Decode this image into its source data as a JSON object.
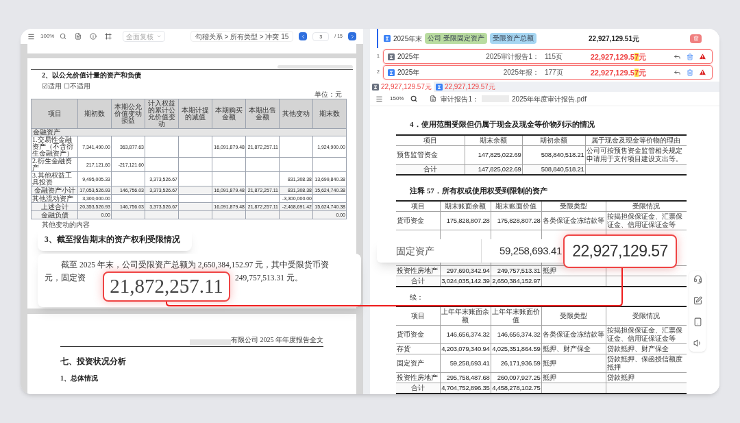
{
  "left_viewer": {
    "toolbar": {
      "zoom": "100%",
      "review_dropdown": "全面复核",
      "filter_path": "勾稽关系 > 所有类型 > 冲突 15",
      "page_input": "3",
      "page_total": "/ 15"
    },
    "page_top": {
      "section_title": "2、以公允价值计量的资产和负债",
      "applicability": "☑适用 ☐不适用",
      "unit": "单位：元",
      "table": {
        "columns": [
          "项目",
          "期初数",
          "本期公允价值变动损益",
          "计入权益的累计公允价值变动",
          "本期计提的减值",
          "本期购买金额",
          "本期出售金额",
          "其他变动",
          "期末数"
        ],
        "rows": [
          {
            "kind": "group",
            "cells": [
              {
                "text": "金融资产",
                "colspan": 9
              }
            ]
          },
          {
            "kind": "data",
            "cells": [
              "1.交易性金融资产（不含衍生金融资产）",
              "7,341,490.00",
              "363,877.63",
              null,
              null,
              "16,091,879.48",
              "21,872,257.11",
              null,
              "1,924,900.00"
            ]
          },
          {
            "kind": "data",
            "cells": [
              "2.衍生金融资产",
              "217,121.60",
              "-217,121.60",
              null,
              null,
              null,
              null,
              null,
              null
            ]
          },
          {
            "kind": "data",
            "cells": [
              "3.其他权益工具投资",
              "9,495,005.33",
              null,
              "3,373,526.67",
              null,
              null,
              null,
              "831,308.38",
              "13,699,840.38"
            ]
          },
          {
            "kind": "total",
            "cells": [
              "金融资产小计",
              "17,053,526.93",
              "146,756.03",
              "3,373,526.67",
              null,
              "16,091,879.48",
              "21,872,257.11",
              "831,308.38",
              "15,624,740.38"
            ]
          },
          {
            "kind": "data",
            "cells": [
              "其他流动资产",
              "3,300,000.00",
              null,
              null,
              null,
              null,
              null,
              "-3,300,000.00",
              null
            ]
          },
          {
            "kind": "total",
            "cells": [
              "上述合计",
              "20,353,526.93",
              "146,756.03",
              "3,373,526.67",
              null,
              "16,091,879.48",
              "21,872,257.11",
              "-2,468,691.42",
              "15,624,740.38"
            ]
          },
          {
            "kind": "total",
            "cells": [
              "金融负债",
              "0.00",
              null,
              null,
              null,
              null,
              null,
              null,
              "0.00"
            ]
          }
        ]
      },
      "note": "其他变动的内容"
    },
    "page_bottom": {
      "header": "有限公司 2025 年年度报告全文",
      "heading": "七、投资状况分析",
      "subheading": "1、总体情况"
    }
  },
  "left_callout": {
    "title": "3、截至报告期末的资产权利受限情况",
    "line_1": "截至 2025 年末，公司受限资产总额为 2,650,384,152.97 元，其中受限货币资",
    "line_2_start": "元，固定资",
    "line_2_end": "249,757,513.31 元。",
    "highlight_value": "21,872,257.11"
  },
  "review_panel": {
    "summary": {
      "year": "2025年末",
      "tags": [
        {
          "label": "公司 受限固定资产",
          "color": "#b9dca0"
        },
        {
          "label": "受限资产总额",
          "color": "#a6d6f2"
        }
      ],
      "amount": "22,927,129.51元"
    },
    "matches": [
      {
        "index": "1",
        "kind": "audit",
        "year": "2025年",
        "source": "2025审计报告1：",
        "page": "115页",
        "amount": "22,927,129.5",
        "diff": "7",
        "unit": "元",
        "conflict": true
      },
      {
        "index": "2",
        "kind": "annual",
        "year": "2025年",
        "source": "2025年报：",
        "page": "177页",
        "amount": "22,927,129.5",
        "diff": "7",
        "unit": "元",
        "conflict": true
      }
    ]
  },
  "value_tabs": [
    {
      "kind": "audit",
      "label": "22,927,129.57元",
      "selected": true
    },
    {
      "kind": "annual",
      "label": "22,927,129.57元",
      "selected": false
    }
  ],
  "doc_toolbar": {
    "zoom": "150%",
    "file_label": "审计报告1：",
    "file_name": "2025年年度审计报告.pdf"
  },
  "document": {
    "title": "4．使用范围受限但仍属于现金及现金等价物列示的情况",
    "table_cash": {
      "columns": [
        "项目",
        "期末余额",
        "期初余额",
        "属于现金及现金等价物的理由"
      ],
      "rows": [
        {
          "kind": "data",
          "cells": [
            "预售监管资金",
            "147,825,022.69",
            "508,840,518.21",
            "公司可按预售资金监管相关规定申请用于支付项目建设支出等。"
          ]
        },
        {
          "kind": "total",
          "cells": [
            "合计",
            "147,825,022.69",
            "508,840,518.21",
            null
          ]
        }
      ]
    },
    "note_title": "注释 57．所有权或使用权受到限制的资产",
    "table_restricted": {
      "columns": [
        "项目",
        "期末账面余额",
        "期末账面价值",
        "受限类型",
        "受限情况"
      ],
      "rows": [
        {
          "kind": "data",
          "cells": [
            "货币资金",
            "175,828,807.28",
            "175,828,807.28",
            "各类保证金冻结款等",
            "按揭担保保证金、汇票保证金、信用证保证金等"
          ]
        },
        {
          "kind": "data",
          "cells": [
            "投资性房地产",
            "297,690,342.94",
            "249,757,513.31",
            "抵押",
            null
          ]
        },
        {
          "kind": "total",
          "cells": [
            "合计",
            "3,024,035,142.39",
            "2,650,384,152.97",
            null,
            null
          ]
        }
      ]
    },
    "continued": "续：",
    "table_prior": {
      "columns": [
        "项目",
        "上年年末账面余额",
        "上年年末账面价值",
        "受限类型",
        "受限情况"
      ],
      "rows": [
        {
          "kind": "data",
          "cells": [
            "货币资金",
            "146,656,374.32",
            "146,656,374.32",
            "各类保证金冻结款等",
            "按揭担保保证金、汇票保证金、信用证保证金等"
          ]
        },
        {
          "kind": "data",
          "cells": [
            "存货",
            "4,203,079,340.94",
            "4,025,351,864.59",
            "抵押、财产保全",
            "贷款抵押、财产保全"
          ]
        },
        {
          "kind": "data",
          "cells": [
            "固定资产",
            "59,258,693.41",
            "26,171,936.59",
            "抵押",
            "贷款抵押、保函授信额度抵押"
          ]
        },
        {
          "kind": "data",
          "cells": [
            "投资性房地产",
            "295,758,487.68",
            "260,097,927.25",
            "抵押",
            "贷款抵押"
          ]
        },
        {
          "kind": "total",
          "cells": [
            "合计",
            "4,704,752,896.35",
            "4,458,278,102.75",
            null,
            null
          ]
        }
      ]
    }
  },
  "right_callout": {
    "label": "固定资产",
    "book_balance": "59,258,693.41",
    "highlight_value": "22,927,129.57"
  }
}
